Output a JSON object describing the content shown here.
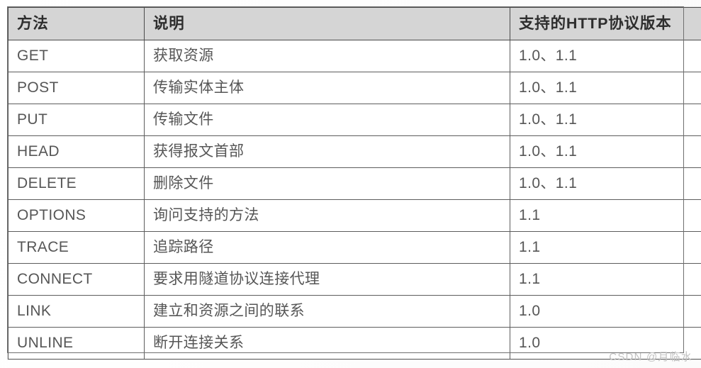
{
  "document": {
    "type": "scanned-book-table",
    "watermark": "CSDN @月临水",
    "colors": {
      "header_background": "#d5d5d5",
      "border": "#5d5d5d",
      "text": "#565656",
      "header_text": "#2e2e2e",
      "page_background": "#ffffff",
      "watermark_text": "#c2c2c2"
    }
  },
  "table": {
    "columns": [
      {
        "key": "method",
        "label": "方法"
      },
      {
        "key": "description",
        "label": "说明"
      },
      {
        "key": "version",
        "label": "支持的HTTP协议版本"
      }
    ],
    "rows": [
      {
        "method": "GET",
        "description": "获取资源",
        "version": "1.0、1.1"
      },
      {
        "method": "POST",
        "description": "传输实体主体",
        "version": "1.0、1.1"
      },
      {
        "method": "PUT",
        "description": "传输文件",
        "version": "1.0、1.1"
      },
      {
        "method": "HEAD",
        "description": "获得报文首部",
        "version": "1.0、1.1"
      },
      {
        "method": "DELETE",
        "description": "删除文件",
        "version": "1.0、1.1"
      },
      {
        "method": "OPTIONS",
        "description": "询问支持的方法",
        "version": "1.1"
      },
      {
        "method": "TRACE",
        "description": "追踪路径",
        "version": "1.1"
      },
      {
        "method": "CONNECT",
        "description": "要求用隧道协议连接代理",
        "version": "1.1"
      },
      {
        "method": "LINK",
        "description": "建立和资源之间的联系",
        "version": "1.0"
      },
      {
        "method": "UNLINE",
        "description": "断开连接关系",
        "version": "1.0"
      }
    ]
  }
}
